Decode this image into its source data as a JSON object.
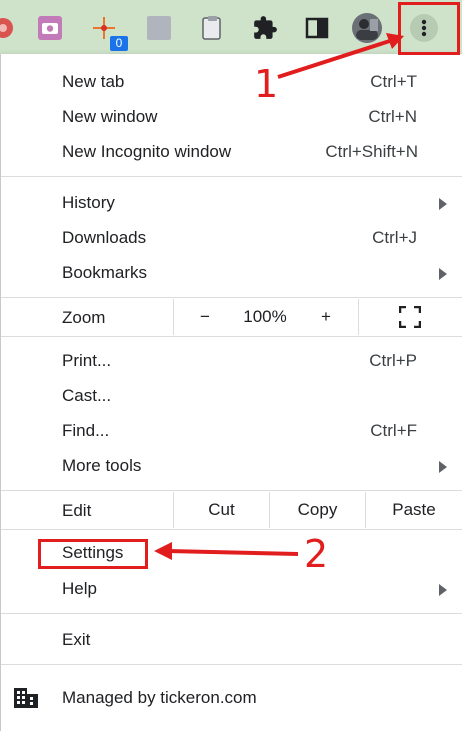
{
  "menu": {
    "new_tab": {
      "label": "New tab",
      "shortcut": "Ctrl+T"
    },
    "new_window": {
      "label": "New window",
      "shortcut": "Ctrl+N"
    },
    "new_incognito": {
      "label": "New Incognito window",
      "shortcut": "Ctrl+Shift+N"
    },
    "history": {
      "label": "History"
    },
    "downloads": {
      "label": "Downloads",
      "shortcut": "Ctrl+J"
    },
    "bookmarks": {
      "label": "Bookmarks"
    },
    "zoom": {
      "label": "Zoom",
      "minus": "−",
      "value": "100%",
      "plus": "+"
    },
    "print": {
      "label": "Print...",
      "shortcut": "Ctrl+P"
    },
    "cast": {
      "label": "Cast..."
    },
    "find": {
      "label": "Find...",
      "shortcut": "Ctrl+F"
    },
    "more_tools": {
      "label": "More tools"
    },
    "edit": {
      "label": "Edit",
      "cut": "Cut",
      "copy": "Copy",
      "paste": "Paste"
    },
    "settings": {
      "label": "Settings"
    },
    "help": {
      "label": "Help"
    },
    "exit": {
      "label": "Exit"
    },
    "managed": {
      "label": "Managed by tickeron.com"
    }
  },
  "toolbar": {
    "badge_count": "0",
    "icons": [
      "extension-red-icon",
      "camera-extension-icon",
      "crosshair-extension-icon",
      "grey-square-extension-icon",
      "clipboard-extension-icon",
      "puzzle-icon",
      "side-panel-icon",
      "profile-avatar",
      "three-dot-menu-icon"
    ]
  },
  "annotations": {
    "step1": "1",
    "step2": "2"
  },
  "colors": {
    "toolbar_bg": "#cfe3cb",
    "annotation_red": "#e11d1d",
    "badge_blue": "#1a73e8"
  }
}
